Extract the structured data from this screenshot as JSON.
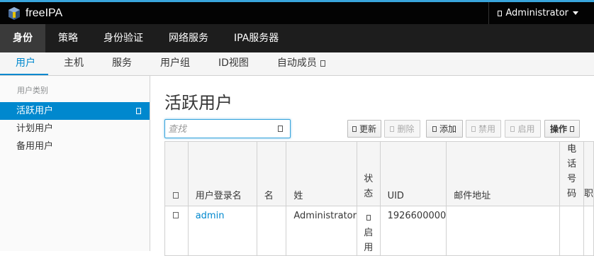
{
  "app": {
    "name": "freeIPA",
    "user": "Administrator"
  },
  "nav_primary": [
    "身份",
    "策略",
    "身份验证",
    "网络服务",
    "IPA服务器"
  ],
  "nav_secondary": [
    "用户",
    "主机",
    "服务",
    "用户组",
    "ID视图",
    "自动成员"
  ],
  "sidebar": {
    "title": "用户类别",
    "items": [
      "活跃用户",
      "计划用户",
      "备用用户"
    ]
  },
  "page": {
    "title": "活跃用户"
  },
  "search": {
    "placeholder": "查找"
  },
  "toolbar": {
    "refresh": "更新",
    "delete": "删除",
    "add": "添加",
    "disable": "禁用",
    "enable": "启用",
    "actions": "操作"
  },
  "table": {
    "headers": {
      "login": "用户登录名",
      "first": "名",
      "last": "姓",
      "status": "状态",
      "uid": "UID",
      "email": "邮件地址",
      "phone": "电话号码",
      "title_partial": "职"
    },
    "rows": [
      {
        "login": "admin",
        "first": "",
        "last": "Administrator",
        "status": "启用",
        "uid": "1926600000",
        "email": "",
        "phone": ""
      }
    ]
  },
  "colors": {
    "accent": "#0088ce",
    "topbar": "#030303",
    "nav": "#1d1d1d"
  }
}
